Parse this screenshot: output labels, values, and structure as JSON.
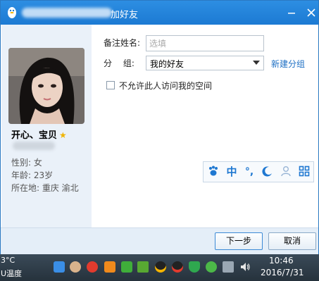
{
  "window": {
    "title": "加好友"
  },
  "profile": {
    "nickname": "开心、宝贝",
    "gender": "性别: 女",
    "age": "年龄: 23岁",
    "location": "所在地: 重庆  渝北"
  },
  "form": {
    "remark_label": "备注姓名:",
    "remark_placeholder": "选填",
    "group_label": "分　 组:",
    "group_value": "我的好友",
    "new_group_link": "新建分组",
    "privacy_checkbox_label": "不允许此人访问我的空间",
    "privacy_checked": false
  },
  "ime": {
    "items": [
      "paw-icon",
      "中",
      "°,",
      "moon-icon",
      "person-icon",
      "grid-icon"
    ],
    "mode_label": "中",
    "punct_label": "°,"
  },
  "buttons": {
    "next": "下一步",
    "cancel": "取消"
  },
  "taskbar": {
    "temperature": "3°C",
    "temperature_label": "U温度",
    "time": "10:46",
    "date": "2016/7/31"
  },
  "colors": {
    "titlebar": "#1c7ad3",
    "link": "#1d6fc4",
    "accent": "#1f78d1"
  }
}
